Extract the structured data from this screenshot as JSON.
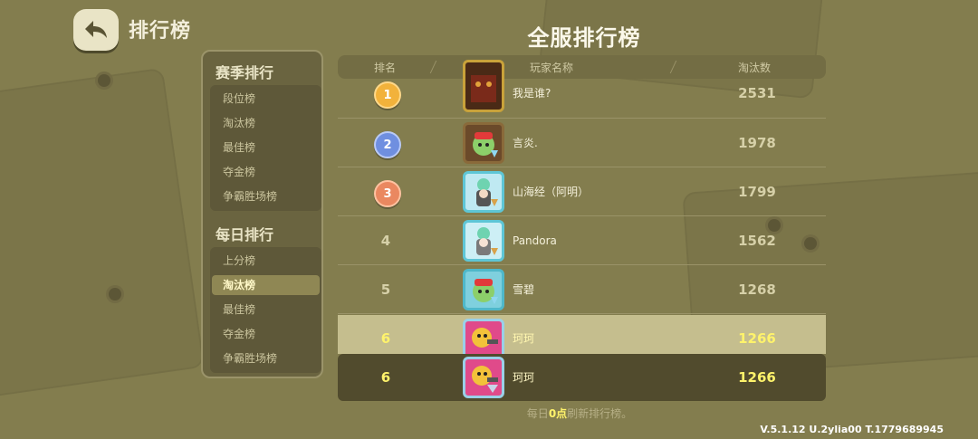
{
  "header": {
    "page_title": "排行榜",
    "main_title": "全服排行榜"
  },
  "sidebar": {
    "season": {
      "title": "赛季排行",
      "items": [
        "段位榜",
        "淘汰榜",
        "最佳榜",
        "夺金榜",
        "争霸胜场榜"
      ]
    },
    "daily": {
      "title": "每日排行",
      "items": [
        "上分榜",
        "淘汰榜",
        "最佳榜",
        "夺金榜",
        "争霸胜场榜"
      ],
      "active_index": 1
    }
  },
  "table": {
    "columns": {
      "rank": "排名",
      "player": "玩家名称",
      "score": "淘汰数"
    },
    "rows": [
      {
        "rank": "1",
        "name": "我是谁?",
        "score": "2531",
        "medal": "gold"
      },
      {
        "rank": "2",
        "name": "言炎.",
        "score": "1978",
        "medal": "silver"
      },
      {
        "rank": "3",
        "name": "山海经（阿明）",
        "score": "1799",
        "medal": "bronze"
      },
      {
        "rank": "4",
        "name": "Pandora",
        "score": "1562"
      },
      {
        "rank": "5",
        "name": "雪碧",
        "score": "1268"
      },
      {
        "rank": "6",
        "name": "珂珂",
        "score": "1266",
        "highlighted": true
      }
    ]
  },
  "self_row": {
    "rank": "6",
    "name": "珂珂",
    "score": "1266"
  },
  "footer": {
    "prefix": "每日",
    "time": "0点",
    "suffix": "刷新排行榜。"
  },
  "version": "V.5.1.12 U.2ylia00 T.1779689945",
  "colors": {
    "highlight_text": "#fff36b",
    "panel": "#6a6440",
    "background": "#837d4e"
  }
}
